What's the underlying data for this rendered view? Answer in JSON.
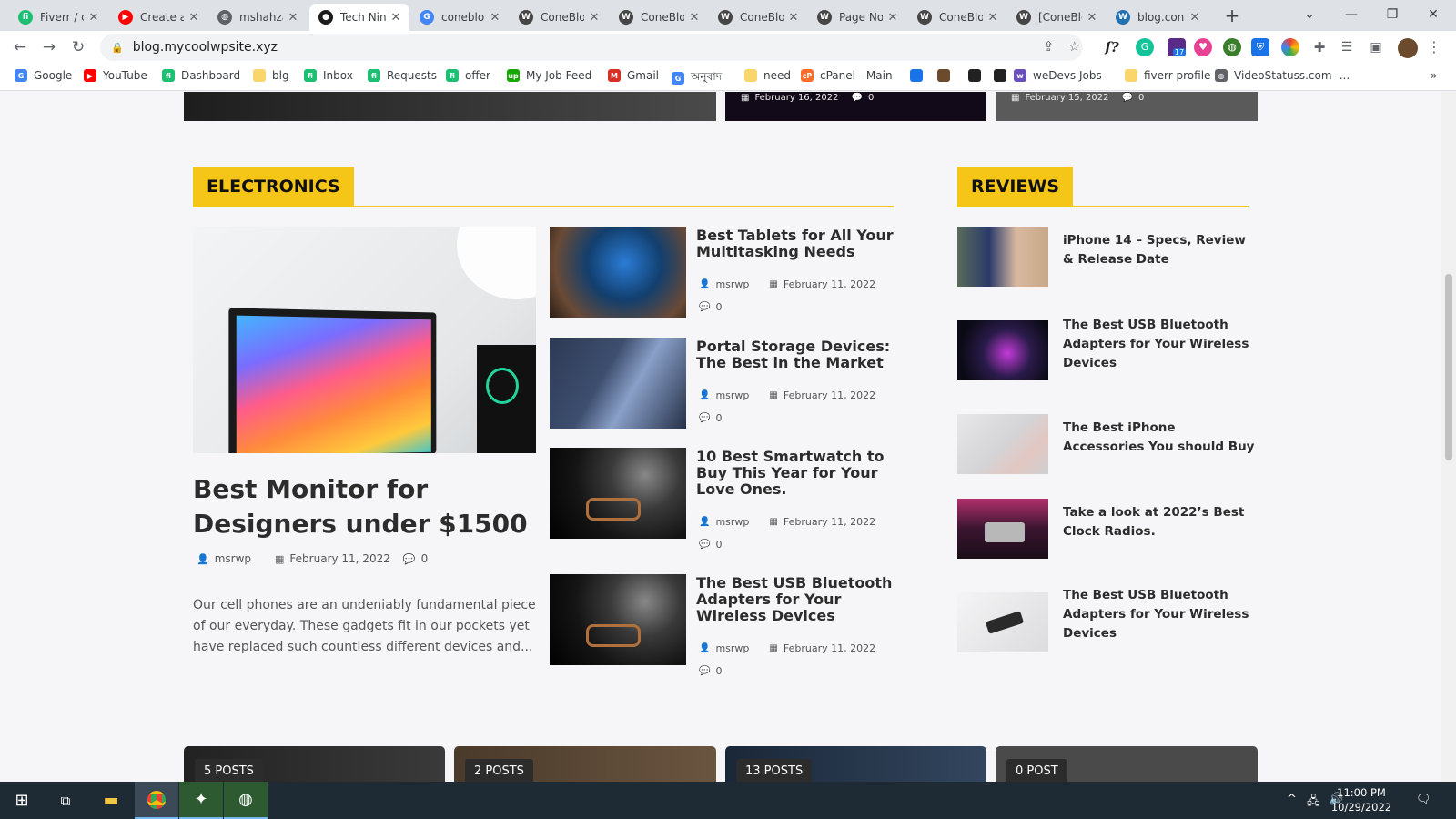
{
  "browser": {
    "tabs": [
      {
        "title": "Fiverr / c",
        "icon": "fiverr-icon",
        "color": "#1dbf73",
        "glyph": "fi"
      },
      {
        "title": "Create a",
        "icon": "youtube-icon",
        "color": "#ff0000",
        "glyph": "▶"
      },
      {
        "title": "mshahza",
        "icon": "globe-icon",
        "color": "#5f6368",
        "glyph": "◍"
      },
      {
        "title": "Tech Nin",
        "icon": "ninja-icon",
        "color": "#1b1b1b",
        "glyph": "●"
      },
      {
        "title": "conebloc",
        "icon": "google-icon",
        "color": "#4285f4",
        "glyph": "G"
      },
      {
        "title": "ConeBlo",
        "icon": "wordpress-icon",
        "color": "#464646",
        "glyph": "W"
      },
      {
        "title": "ConeBlo",
        "icon": "wordpress-icon",
        "color": "#464646",
        "glyph": "W"
      },
      {
        "title": "ConeBlo",
        "icon": "wordpress-icon",
        "color": "#464646",
        "glyph": "W"
      },
      {
        "title": "Page No",
        "icon": "wordpress-icon",
        "color": "#464646",
        "glyph": "W"
      },
      {
        "title": "ConeBlo",
        "icon": "wordpress-icon",
        "color": "#464646",
        "glyph": "W"
      },
      {
        "title": "[ConeBlo",
        "icon": "wordpress-icon",
        "color": "#464646",
        "glyph": "W"
      },
      {
        "title": "blog.con",
        "icon": "wordpress-icon",
        "color": "#2271b1",
        "glyph": "W"
      }
    ],
    "close_glyph": "✕",
    "new_tab_glyph": "+",
    "url": "blog.mycoolwpsite.xyz",
    "bookmarks": [
      {
        "label": "Google",
        "icon": "google-icon",
        "color": "#4285f4",
        "glyph": "G"
      },
      {
        "label": "YouTube",
        "icon": "youtube-icon",
        "color": "#ff0000",
        "glyph": "▶"
      },
      {
        "label": "Dashboard",
        "icon": "fiverr-icon",
        "color": "#1dbf73",
        "glyph": "fi"
      },
      {
        "label": "blg",
        "icon": "folder-icon",
        "color": "#f9d66b",
        "glyph": ""
      },
      {
        "label": "Inbox",
        "icon": "fiverr-icon",
        "color": "#1dbf73",
        "glyph": "fi"
      },
      {
        "label": "Requests",
        "icon": "fiverr-icon",
        "color": "#1dbf73",
        "glyph": "fi"
      },
      {
        "label": "offer",
        "icon": "fiverr-icon",
        "color": "#1dbf73",
        "glyph": "fi"
      },
      {
        "label": "My Job Feed",
        "icon": "upwork-icon",
        "color": "#14a800",
        "glyph": "up"
      },
      {
        "label": "Gmail",
        "icon": "gmail-icon",
        "color": "#d93025",
        "glyph": "M"
      },
      {
        "label": "অনুবাদ",
        "icon": "translate-icon",
        "color": "#4285f4",
        "glyph": "G"
      },
      {
        "label": "need",
        "icon": "folder-icon",
        "color": "#f9d66b",
        "glyph": ""
      },
      {
        "label": "cPanel - Main",
        "icon": "cpanel-icon",
        "color": "#ff6c2c",
        "glyph": "cP"
      },
      {
        "label": "weDevs Jobs",
        "icon": "wedevs-icon",
        "color": "#6b4fbb",
        "glyph": "w"
      },
      {
        "label": "fiverr profile",
        "icon": "folder-icon",
        "color": "#f9d66b",
        "glyph": ""
      },
      {
        "label": "VideoStatuss.com -...",
        "icon": "globe-icon",
        "color": "#5f6368",
        "glyph": "◍"
      }
    ],
    "more_bookmarks_glyph": "»"
  },
  "page": {
    "top_cards": [
      {
        "date": "",
        "comments": ""
      },
      {
        "date": "February 16, 2022",
        "comments": "0"
      },
      {
        "date": "February 15, 2022",
        "comments": "0"
      }
    ],
    "electronics": {
      "heading": "ELECTRONICS",
      "featured": {
        "title": "Best Monitor for Designers under $1500",
        "author": "msrwp",
        "date": "February 11, 2022",
        "comments": "0",
        "excerpt": "Our cell phones are an undeniably fundamental piece of our everyday. These gadgets fit in our pockets yet have replaced such countless different devices and..."
      },
      "posts": [
        {
          "title": "Best Tablets for All Your Multitasking Needs",
          "author": "msrwp",
          "date": "February 11, 2022",
          "comments": "0"
        },
        {
          "title": "Portal Storage Devices: The Best in the Market",
          "author": "msrwp",
          "date": "February 11, 2022",
          "comments": "0"
        },
        {
          "title": "10 Best Smartwatch to Buy This Year for Your Love Ones.",
          "author": "msrwp",
          "date": "February 11, 2022",
          "comments": "0"
        },
        {
          "title": "The Best USB Bluetooth Adapters for Your Wireless Devices",
          "author": "msrwp",
          "date": "February 11, 2022",
          "comments": "0"
        }
      ]
    },
    "reviews": {
      "heading": "REVIEWS",
      "posts": [
        {
          "title": "iPhone 14 – Specs, Review & Release Date"
        },
        {
          "title": "The Best USB Bluetooth Adapters for Your Wireless Devices"
        },
        {
          "title": "The Best iPhone Accessories You should Buy"
        },
        {
          "title": "Take a look at 2022’s Best Clock Radios."
        },
        {
          "title": "The Best USB Bluetooth Adapters for Your Wireless Devices"
        }
      ]
    },
    "categories": [
      {
        "count": "5 POSTS"
      },
      {
        "count": "2 POSTS"
      },
      {
        "count": "13 POSTS"
      },
      {
        "count": "0 POST"
      }
    ],
    "accent_color": "#f5c518"
  },
  "taskbar": {
    "time": "11:00 PM",
    "date": "10/29/2022",
    "extension_badge": "17"
  }
}
